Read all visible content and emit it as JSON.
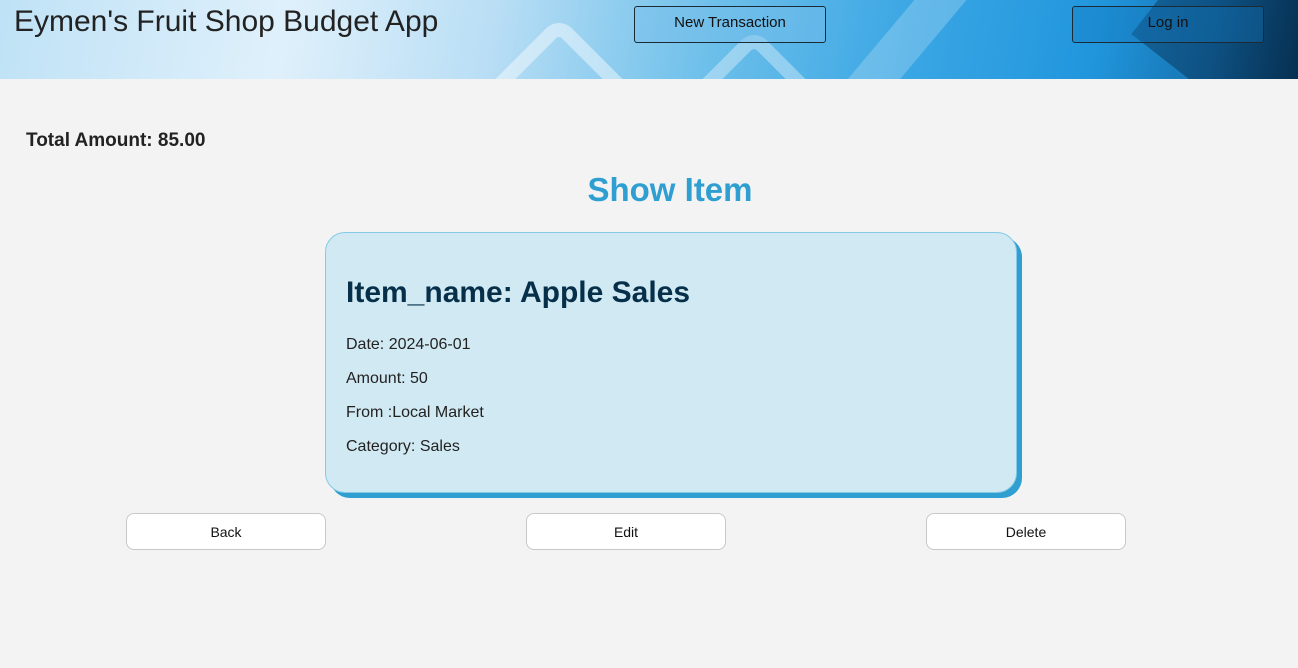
{
  "header": {
    "app_title": "Eymen's Fruit Shop Budget App",
    "new_transaction_label": "New Transaction",
    "login_label": "Log in"
  },
  "summary": {
    "total_text": "Total Amount: 85.00"
  },
  "page": {
    "title": "Show Item"
  },
  "item": {
    "name_line": "Item_name: Apple Sales",
    "date_line": "Date: 2024-06-01",
    "amount_line": "Amount: 50",
    "from_line": "From :Local Market",
    "category_line": "Category: Sales"
  },
  "actions": {
    "back_label": "Back",
    "edit_label": "Edit",
    "delete_label": "Delete"
  },
  "colors": {
    "accent": "#2f9ed1",
    "card_bg": "#d1e9f3",
    "heading_dark": "#062f49",
    "page_bg": "#f3f3f3"
  }
}
